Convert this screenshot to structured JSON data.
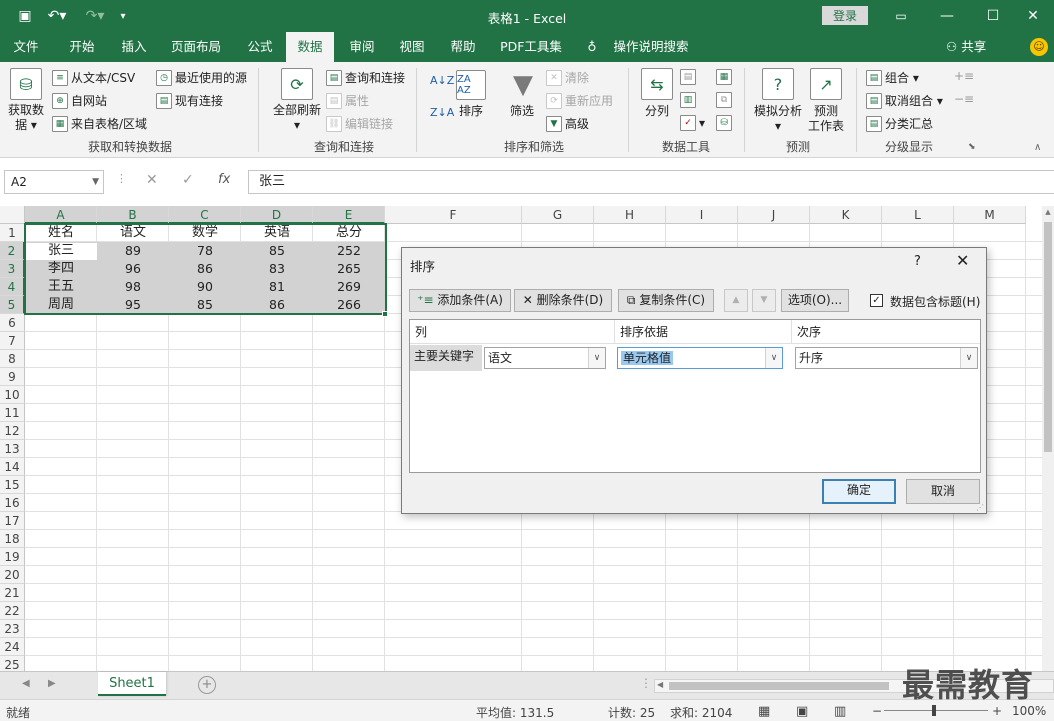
{
  "window": {
    "title": "表格1 - Excel",
    "login": "登录",
    "min_icon": "minimize-icon",
    "max_icon": "maximize-icon",
    "close_icon": "close-icon"
  },
  "menu": {
    "tabs": [
      "文件",
      "开始",
      "插入",
      "页面布局",
      "公式",
      "数据",
      "审阅",
      "视图",
      "帮助",
      "PDF工具集",
      "操作说明搜索"
    ],
    "active": "数据",
    "share": "共享"
  },
  "ribbon": {
    "get_data": {
      "big_label_1": "获取数",
      "big_label_2": "据",
      "from_text": "从文本/CSV",
      "from_web": "自网站",
      "from_table": "来自表格/区域",
      "recent": "最近使用的源",
      "existing": "现有连接",
      "group": "获取和转换数据"
    },
    "queries": {
      "refresh": "全部刷新",
      "queries_conn": "查询和连接",
      "properties": "属性",
      "edit_links": "编辑链接",
      "group": "查询和连接"
    },
    "sort_filter": {
      "sort": "排序",
      "filter": "筛选",
      "clear": "清除",
      "reapply": "重新应用",
      "advanced": "高级",
      "group": "排序和筛选"
    },
    "data_tools": {
      "split": "分列",
      "group": "数据工具"
    },
    "forecast": {
      "whatif": "模拟分析",
      "sheet_1": "预测",
      "sheet_2": "工作表",
      "group": "预测"
    },
    "outline": {
      "group_btn": "组合",
      "ungroup": "取消组合",
      "subtotal": "分类汇总",
      "group": "分级显示"
    }
  },
  "formula_bar": {
    "name_box": "A2",
    "cancel": "✕",
    "enter": "✓",
    "fx": "fx",
    "value": "张三"
  },
  "sheet": {
    "columns": [
      "A",
      "B",
      "C",
      "D",
      "E",
      "F",
      "G",
      "H",
      "I",
      "J",
      "K",
      "L",
      "M"
    ],
    "rows": [
      "1",
      "2",
      "3",
      "4",
      "5",
      "6",
      "7",
      "8",
      "9",
      "10",
      "11",
      "12",
      "13",
      "14",
      "15",
      "16",
      "17",
      "18",
      "19",
      "20",
      "21",
      "22",
      "23",
      "24",
      "25"
    ],
    "header": [
      "姓名",
      "语文",
      "数学",
      "英语",
      "总分"
    ],
    "data": [
      [
        "张三",
        "89",
        "78",
        "85",
        "252"
      ],
      [
        "李四",
        "96",
        "86",
        "83",
        "265"
      ],
      [
        "王五",
        "98",
        "90",
        "81",
        "269"
      ],
      [
        "周周",
        "95",
        "85",
        "86",
        "266"
      ]
    ],
    "tab": "Sheet1"
  },
  "status": {
    "ready": "就绪",
    "average": "平均值: 131.5",
    "count": "计数: 25",
    "sum": "求和: 2104",
    "zoom": "100%"
  },
  "watermark": "最需教育",
  "dialog": {
    "title": "排序",
    "help": "?",
    "close": "✕",
    "add": "添加条件(A)",
    "delete": "删除条件(D)",
    "copy": "复制条件(C)",
    "options": "选项(O)...",
    "has_header": "数据包含标题(H)",
    "col_header": "列",
    "basis_header": "排序依据",
    "order_header": "次序",
    "row_label": "主要关键字",
    "col_value": "语文",
    "basis_value": "单元格值",
    "order_value": "升序",
    "ok": "确定",
    "cancel": "取消"
  }
}
